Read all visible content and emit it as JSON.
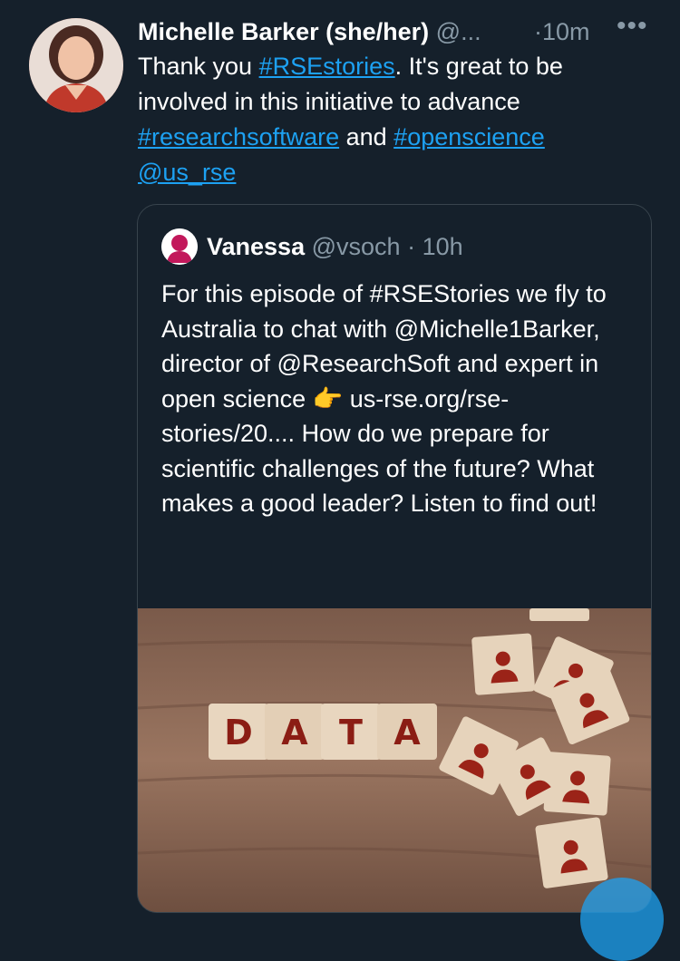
{
  "tweet": {
    "author_name": "Michelle Barker (she/her)",
    "author_handle": "@...",
    "time": "·10m",
    "more_label": "•••",
    "text_1": "Thank you ",
    "tag_rsestories": "#RSEstories",
    "text_2": ". It's great to be involved in this initiative to advance ",
    "tag_researchsoftware": "#researchsoftware",
    "text_3": " and ",
    "tag_openscience": "#openscience",
    "mention_usrse": "@us_rse"
  },
  "quoted": {
    "author_name": "Vanessa",
    "author_handle": "@vsoch",
    "time": "· 10h",
    "text": "For this episode of #RSEStories we fly to Australia to chat with @Michelle1Barker, director of @ResearchSoft and expert in open science 👉 us-rse.org/rse-stories/20.... How do we prepare for scientific challenges of the future? What makes a good leader? Listen to find out!",
    "image_letters": [
      "D",
      "A",
      "T",
      "A"
    ]
  },
  "colors": {
    "background": "#15202b",
    "link": "#1da1f2",
    "muted": "#8899a6",
    "border": "#38444d"
  },
  "icons": {
    "avatar": "user-photo",
    "quoted_avatar": "user-silhouette-icon",
    "more": "more-horizontal-icon"
  }
}
